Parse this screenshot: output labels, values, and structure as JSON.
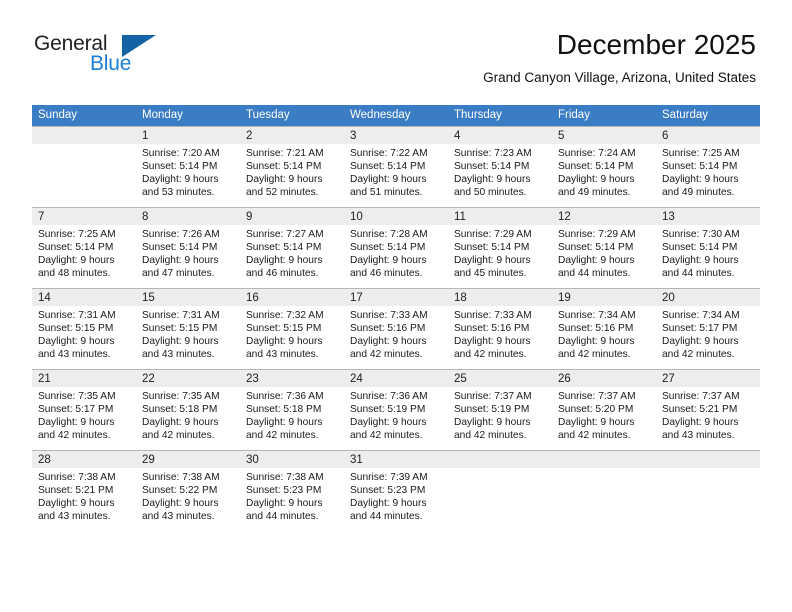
{
  "brand": {
    "name_part1": "General",
    "name_part2": "Blue",
    "triangle_color": "#1464a5",
    "blue_color": "#1a7fd4"
  },
  "header": {
    "month_title": "December 2025",
    "location": "Grand Canyon Village, Arizona, United States",
    "header_bg_color": "#3b7dc4"
  },
  "weekdays": [
    "Sunday",
    "Monday",
    "Tuesday",
    "Wednesday",
    "Thursday",
    "Friday",
    "Saturday"
  ],
  "weeks": [
    [
      {
        "day": "",
        "sunrise": "",
        "sunset": "",
        "daylight1": "",
        "daylight2": "",
        "empty": true
      },
      {
        "day": "1",
        "sunrise": "Sunrise: 7:20 AM",
        "sunset": "Sunset: 5:14 PM",
        "daylight1": "Daylight: 9 hours",
        "daylight2": "and 53 minutes.",
        "empty": false
      },
      {
        "day": "2",
        "sunrise": "Sunrise: 7:21 AM",
        "sunset": "Sunset: 5:14 PM",
        "daylight1": "Daylight: 9 hours",
        "daylight2": "and 52 minutes.",
        "empty": false
      },
      {
        "day": "3",
        "sunrise": "Sunrise: 7:22 AM",
        "sunset": "Sunset: 5:14 PM",
        "daylight1": "Daylight: 9 hours",
        "daylight2": "and 51 minutes.",
        "empty": false
      },
      {
        "day": "4",
        "sunrise": "Sunrise: 7:23 AM",
        "sunset": "Sunset: 5:14 PM",
        "daylight1": "Daylight: 9 hours",
        "daylight2": "and 50 minutes.",
        "empty": false
      },
      {
        "day": "5",
        "sunrise": "Sunrise: 7:24 AM",
        "sunset": "Sunset: 5:14 PM",
        "daylight1": "Daylight: 9 hours",
        "daylight2": "and 49 minutes.",
        "empty": false
      },
      {
        "day": "6",
        "sunrise": "Sunrise: 7:25 AM",
        "sunset": "Sunset: 5:14 PM",
        "daylight1": "Daylight: 9 hours",
        "daylight2": "and 49 minutes.",
        "empty": false
      }
    ],
    [
      {
        "day": "7",
        "sunrise": "Sunrise: 7:25 AM",
        "sunset": "Sunset: 5:14 PM",
        "daylight1": "Daylight: 9 hours",
        "daylight2": "and 48 minutes.",
        "empty": false
      },
      {
        "day": "8",
        "sunrise": "Sunrise: 7:26 AM",
        "sunset": "Sunset: 5:14 PM",
        "daylight1": "Daylight: 9 hours",
        "daylight2": "and 47 minutes.",
        "empty": false
      },
      {
        "day": "9",
        "sunrise": "Sunrise: 7:27 AM",
        "sunset": "Sunset: 5:14 PM",
        "daylight1": "Daylight: 9 hours",
        "daylight2": "and 46 minutes.",
        "empty": false
      },
      {
        "day": "10",
        "sunrise": "Sunrise: 7:28 AM",
        "sunset": "Sunset: 5:14 PM",
        "daylight1": "Daylight: 9 hours",
        "daylight2": "and 46 minutes.",
        "empty": false
      },
      {
        "day": "11",
        "sunrise": "Sunrise: 7:29 AM",
        "sunset": "Sunset: 5:14 PM",
        "daylight1": "Daylight: 9 hours",
        "daylight2": "and 45 minutes.",
        "empty": false
      },
      {
        "day": "12",
        "sunrise": "Sunrise: 7:29 AM",
        "sunset": "Sunset: 5:14 PM",
        "daylight1": "Daylight: 9 hours",
        "daylight2": "and 44 minutes.",
        "empty": false
      },
      {
        "day": "13",
        "sunrise": "Sunrise: 7:30 AM",
        "sunset": "Sunset: 5:14 PM",
        "daylight1": "Daylight: 9 hours",
        "daylight2": "and 44 minutes.",
        "empty": false
      }
    ],
    [
      {
        "day": "14",
        "sunrise": "Sunrise: 7:31 AM",
        "sunset": "Sunset: 5:15 PM",
        "daylight1": "Daylight: 9 hours",
        "daylight2": "and 43 minutes.",
        "empty": false
      },
      {
        "day": "15",
        "sunrise": "Sunrise: 7:31 AM",
        "sunset": "Sunset: 5:15 PM",
        "daylight1": "Daylight: 9 hours",
        "daylight2": "and 43 minutes.",
        "empty": false
      },
      {
        "day": "16",
        "sunrise": "Sunrise: 7:32 AM",
        "sunset": "Sunset: 5:15 PM",
        "daylight1": "Daylight: 9 hours",
        "daylight2": "and 43 minutes.",
        "empty": false
      },
      {
        "day": "17",
        "sunrise": "Sunrise: 7:33 AM",
        "sunset": "Sunset: 5:16 PM",
        "daylight1": "Daylight: 9 hours",
        "daylight2": "and 42 minutes.",
        "empty": false
      },
      {
        "day": "18",
        "sunrise": "Sunrise: 7:33 AM",
        "sunset": "Sunset: 5:16 PM",
        "daylight1": "Daylight: 9 hours",
        "daylight2": "and 42 minutes.",
        "empty": false
      },
      {
        "day": "19",
        "sunrise": "Sunrise: 7:34 AM",
        "sunset": "Sunset: 5:16 PM",
        "daylight1": "Daylight: 9 hours",
        "daylight2": "and 42 minutes.",
        "empty": false
      },
      {
        "day": "20",
        "sunrise": "Sunrise: 7:34 AM",
        "sunset": "Sunset: 5:17 PM",
        "daylight1": "Daylight: 9 hours",
        "daylight2": "and 42 minutes.",
        "empty": false
      }
    ],
    [
      {
        "day": "21",
        "sunrise": "Sunrise: 7:35 AM",
        "sunset": "Sunset: 5:17 PM",
        "daylight1": "Daylight: 9 hours",
        "daylight2": "and 42 minutes.",
        "empty": false
      },
      {
        "day": "22",
        "sunrise": "Sunrise: 7:35 AM",
        "sunset": "Sunset: 5:18 PM",
        "daylight1": "Daylight: 9 hours",
        "daylight2": "and 42 minutes.",
        "empty": false
      },
      {
        "day": "23",
        "sunrise": "Sunrise: 7:36 AM",
        "sunset": "Sunset: 5:18 PM",
        "daylight1": "Daylight: 9 hours",
        "daylight2": "and 42 minutes.",
        "empty": false
      },
      {
        "day": "24",
        "sunrise": "Sunrise: 7:36 AM",
        "sunset": "Sunset: 5:19 PM",
        "daylight1": "Daylight: 9 hours",
        "daylight2": "and 42 minutes.",
        "empty": false
      },
      {
        "day": "25",
        "sunrise": "Sunrise: 7:37 AM",
        "sunset": "Sunset: 5:19 PM",
        "daylight1": "Daylight: 9 hours",
        "daylight2": "and 42 minutes.",
        "empty": false
      },
      {
        "day": "26",
        "sunrise": "Sunrise: 7:37 AM",
        "sunset": "Sunset: 5:20 PM",
        "daylight1": "Daylight: 9 hours",
        "daylight2": "and 42 minutes.",
        "empty": false
      },
      {
        "day": "27",
        "sunrise": "Sunrise: 7:37 AM",
        "sunset": "Sunset: 5:21 PM",
        "daylight1": "Daylight: 9 hours",
        "daylight2": "and 43 minutes.",
        "empty": false
      }
    ],
    [
      {
        "day": "28",
        "sunrise": "Sunrise: 7:38 AM",
        "sunset": "Sunset: 5:21 PM",
        "daylight1": "Daylight: 9 hours",
        "daylight2": "and 43 minutes.",
        "empty": false
      },
      {
        "day": "29",
        "sunrise": "Sunrise: 7:38 AM",
        "sunset": "Sunset: 5:22 PM",
        "daylight1": "Daylight: 9 hours",
        "daylight2": "and 43 minutes.",
        "empty": false
      },
      {
        "day": "30",
        "sunrise": "Sunrise: 7:38 AM",
        "sunset": "Sunset: 5:23 PM",
        "daylight1": "Daylight: 9 hours",
        "daylight2": "and 44 minutes.",
        "empty": false
      },
      {
        "day": "31",
        "sunrise": "Sunrise: 7:39 AM",
        "sunset": "Sunset: 5:23 PM",
        "daylight1": "Daylight: 9 hours",
        "daylight2": "and 44 minutes.",
        "empty": false
      },
      {
        "day": "",
        "sunrise": "",
        "sunset": "",
        "daylight1": "",
        "daylight2": "",
        "empty": true
      },
      {
        "day": "",
        "sunrise": "",
        "sunset": "",
        "daylight1": "",
        "daylight2": "",
        "empty": true
      },
      {
        "day": "",
        "sunrise": "",
        "sunset": "",
        "daylight1": "",
        "daylight2": "",
        "empty": true
      }
    ]
  ]
}
